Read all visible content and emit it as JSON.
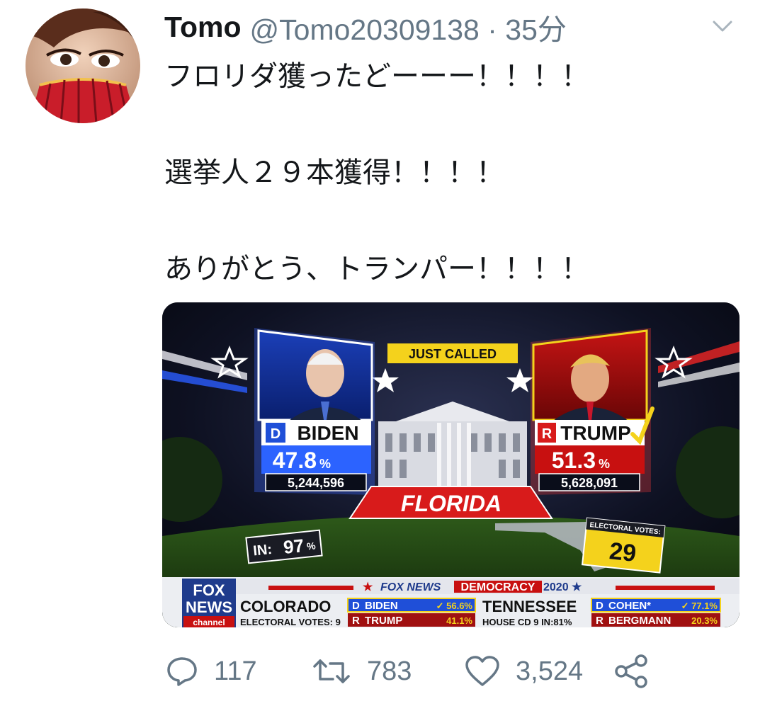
{
  "tweet": {
    "author_name": "Tomo",
    "handle_and_time": "@Tomo20309138 · 35分",
    "lines": [
      "フロリダ獲ったどーーー！！！！",
      "",
      "選挙人２９本獲得！！！！",
      "",
      "ありがとう、トランパー！！！！"
    ]
  },
  "media": {
    "just_called": "JUST CALLED",
    "dem": {
      "party": "D",
      "name": "BIDEN",
      "pct": "47.8",
      "pct_sign": "%",
      "votes": "5,244,596"
    },
    "rep": {
      "party": "R",
      "name": "TRUMP",
      "pct": "51.3",
      "pct_sign": "%",
      "votes": "5,628,091"
    },
    "state": "FLORIDA",
    "in_label": "IN:",
    "in_value": "97",
    "in_sign": "%",
    "ev_label": "ELECTORAL VOTES:",
    "ev_value": "29",
    "ticker": {
      "logo_top": "FOX",
      "logo_mid": "NEWS",
      "logo_bottom": "channel",
      "banner_prefix": "★ ",
      "banner_brand": "FOX NEWS ",
      "banner_highlight": "DEMOCRACY",
      "banner_year": " 2020 ★",
      "race1_state": "COLORADO",
      "race1_sub": "ELECTORAL VOTES: 9",
      "race1_c1_party": "D",
      "race1_c1_name": "BIDEN",
      "race1_c1_pct": "✓ 56.6%",
      "race1_c2_party": "R",
      "race1_c2_name": "TRUMP",
      "race1_c2_pct": "41.1%",
      "race2_state": "TENNESSEE",
      "race2_sub": "HOUSE CD 9  IN:81%",
      "race2_c1_party": "D",
      "race2_c1_name": "COHEN*",
      "race2_c1_pct": "✓ 77.1%",
      "race2_c2_party": "R",
      "race2_c2_name": "BERGMANN",
      "race2_c2_pct": "20.3%"
    }
  },
  "actions": {
    "reply_count": "117",
    "retweet_count": "783",
    "like_count": "3,524"
  },
  "colors": {
    "text": "#14171a",
    "secondary": "#657786",
    "dem_blue": "#1f4fd8",
    "rep_red": "#d81b1b",
    "gold": "#f4d21c"
  }
}
